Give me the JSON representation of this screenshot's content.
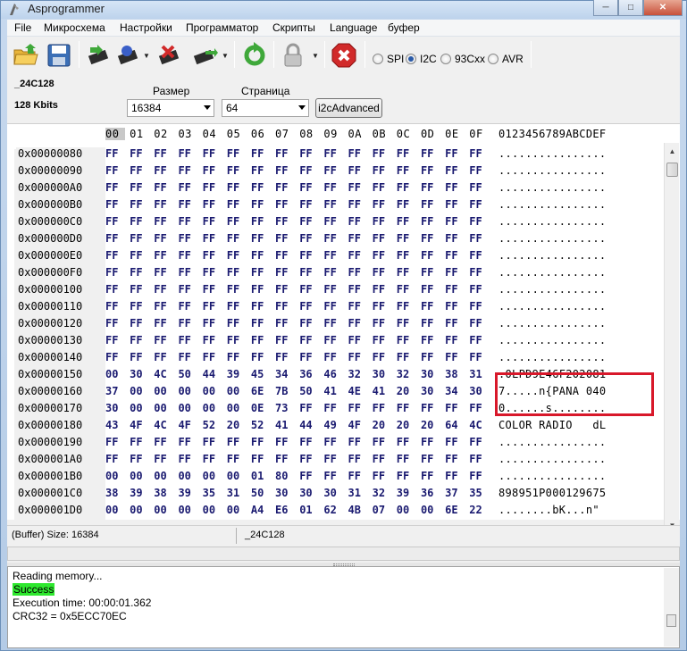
{
  "window": {
    "title": "Asprogrammer"
  },
  "menu": [
    "File",
    "Микросхема",
    "Настройки",
    "Программатор",
    "Скрипты",
    "Language",
    "буфер"
  ],
  "toolbar": {
    "icons": [
      "open-folder-icon",
      "save-disk-icon",
      "read-chip-icon",
      "write-chip-icon",
      "erase-chip-icon",
      "verify-chip-icon",
      "refresh-icon",
      "lock-icon",
      "stop-icon"
    ],
    "protocols": [
      {
        "label": "SPI",
        "selected": false
      },
      {
        "label": "I2C",
        "selected": true
      },
      {
        "label": "93Cxx",
        "selected": false
      },
      {
        "label": "AVR",
        "selected": false
      }
    ]
  },
  "chip": {
    "name": "_24C128",
    "size": "128 Kbits"
  },
  "size_field": {
    "label": "Размер",
    "value": "16384"
  },
  "page_field": {
    "label": "Страница",
    "value": "64"
  },
  "i2c_button": "i2cAdvanced",
  "hex": {
    "columns": [
      "00",
      "01",
      "02",
      "03",
      "04",
      "05",
      "06",
      "07",
      "08",
      "09",
      "0A",
      "0B",
      "0C",
      "0D",
      "0E",
      "0F"
    ],
    "ascii_header": "0123456789ABCDEF",
    "rows": [
      {
        "addr": "0x00000080",
        "bytes": [
          "FF",
          "FF",
          "FF",
          "FF",
          "FF",
          "FF",
          "FF",
          "FF",
          "FF",
          "FF",
          "FF",
          "FF",
          "FF",
          "FF",
          "FF",
          "FF"
        ],
        "ascii": "................"
      },
      {
        "addr": "0x00000090",
        "bytes": [
          "FF",
          "FF",
          "FF",
          "FF",
          "FF",
          "FF",
          "FF",
          "FF",
          "FF",
          "FF",
          "FF",
          "FF",
          "FF",
          "FF",
          "FF",
          "FF"
        ],
        "ascii": "................"
      },
      {
        "addr": "0x000000A0",
        "bytes": [
          "FF",
          "FF",
          "FF",
          "FF",
          "FF",
          "FF",
          "FF",
          "FF",
          "FF",
          "FF",
          "FF",
          "FF",
          "FF",
          "FF",
          "FF",
          "FF"
        ],
        "ascii": "................"
      },
      {
        "addr": "0x000000B0",
        "bytes": [
          "FF",
          "FF",
          "FF",
          "FF",
          "FF",
          "FF",
          "FF",
          "FF",
          "FF",
          "FF",
          "FF",
          "FF",
          "FF",
          "FF",
          "FF",
          "FF"
        ],
        "ascii": "................"
      },
      {
        "addr": "0x000000C0",
        "bytes": [
          "FF",
          "FF",
          "FF",
          "FF",
          "FF",
          "FF",
          "FF",
          "FF",
          "FF",
          "FF",
          "FF",
          "FF",
          "FF",
          "FF",
          "FF",
          "FF"
        ],
        "ascii": "................"
      },
      {
        "addr": "0x000000D0",
        "bytes": [
          "FF",
          "FF",
          "FF",
          "FF",
          "FF",
          "FF",
          "FF",
          "FF",
          "FF",
          "FF",
          "FF",
          "FF",
          "FF",
          "FF",
          "FF",
          "FF"
        ],
        "ascii": "................"
      },
      {
        "addr": "0x000000E0",
        "bytes": [
          "FF",
          "FF",
          "FF",
          "FF",
          "FF",
          "FF",
          "FF",
          "FF",
          "FF",
          "FF",
          "FF",
          "FF",
          "FF",
          "FF",
          "FF",
          "FF"
        ],
        "ascii": "................"
      },
      {
        "addr": "0x000000F0",
        "bytes": [
          "FF",
          "FF",
          "FF",
          "FF",
          "FF",
          "FF",
          "FF",
          "FF",
          "FF",
          "FF",
          "FF",
          "FF",
          "FF",
          "FF",
          "FF",
          "FF"
        ],
        "ascii": "................"
      },
      {
        "addr": "0x00000100",
        "bytes": [
          "FF",
          "FF",
          "FF",
          "FF",
          "FF",
          "FF",
          "FF",
          "FF",
          "FF",
          "FF",
          "FF",
          "FF",
          "FF",
          "FF",
          "FF",
          "FF"
        ],
        "ascii": "................"
      },
      {
        "addr": "0x00000110",
        "bytes": [
          "FF",
          "FF",
          "FF",
          "FF",
          "FF",
          "FF",
          "FF",
          "FF",
          "FF",
          "FF",
          "FF",
          "FF",
          "FF",
          "FF",
          "FF",
          "FF"
        ],
        "ascii": "................"
      },
      {
        "addr": "0x00000120",
        "bytes": [
          "FF",
          "FF",
          "FF",
          "FF",
          "FF",
          "FF",
          "FF",
          "FF",
          "FF",
          "FF",
          "FF",
          "FF",
          "FF",
          "FF",
          "FF",
          "FF"
        ],
        "ascii": "................"
      },
      {
        "addr": "0x00000130",
        "bytes": [
          "FF",
          "FF",
          "FF",
          "FF",
          "FF",
          "FF",
          "FF",
          "FF",
          "FF",
          "FF",
          "FF",
          "FF",
          "FF",
          "FF",
          "FF",
          "FF"
        ],
        "ascii": "................"
      },
      {
        "addr": "0x00000140",
        "bytes": [
          "FF",
          "FF",
          "FF",
          "FF",
          "FF",
          "FF",
          "FF",
          "FF",
          "FF",
          "FF",
          "FF",
          "FF",
          "FF",
          "FF",
          "FF",
          "FF"
        ],
        "ascii": "................"
      },
      {
        "addr": "0x00000150",
        "bytes": [
          "00",
          "30",
          "4C",
          "50",
          "44",
          "39",
          "45",
          "34",
          "36",
          "46",
          "32",
          "30",
          "32",
          "30",
          "38",
          "31"
        ],
        "ascii": ".0LPD9E46F202081"
      },
      {
        "addr": "0x00000160",
        "bytes": [
          "37",
          "00",
          "00",
          "00",
          "00",
          "00",
          "6E",
          "7B",
          "50",
          "41",
          "4E",
          "41",
          "20",
          "30",
          "34",
          "30"
        ],
        "ascii": "7.....n{PANA 040"
      },
      {
        "addr": "0x00000170",
        "bytes": [
          "30",
          "00",
          "00",
          "00",
          "00",
          "00",
          "0E",
          "73",
          "FF",
          "FF",
          "FF",
          "FF",
          "FF",
          "FF",
          "FF",
          "FF"
        ],
        "ascii": "0......s........"
      },
      {
        "addr": "0x00000180",
        "bytes": [
          "43",
          "4F",
          "4C",
          "4F",
          "52",
          "20",
          "52",
          "41",
          "44",
          "49",
          "4F",
          "20",
          "20",
          "20",
          "64",
          "4C"
        ],
        "ascii": "COLOR RADIO   dL"
      },
      {
        "addr": "0x00000190",
        "bytes": [
          "FF",
          "FF",
          "FF",
          "FF",
          "FF",
          "FF",
          "FF",
          "FF",
          "FF",
          "FF",
          "FF",
          "FF",
          "FF",
          "FF",
          "FF",
          "FF"
        ],
        "ascii": "................"
      },
      {
        "addr": "0x000001A0",
        "bytes": [
          "FF",
          "FF",
          "FF",
          "FF",
          "FF",
          "FF",
          "FF",
          "FF",
          "FF",
          "FF",
          "FF",
          "FF",
          "FF",
          "FF",
          "FF",
          "FF"
        ],
        "ascii": "................"
      },
      {
        "addr": "0x000001B0",
        "bytes": [
          "00",
          "00",
          "00",
          "00",
          "00",
          "00",
          "01",
          "80",
          "FF",
          "FF",
          "FF",
          "FF",
          "FF",
          "FF",
          "FF",
          "FF"
        ],
        "ascii": "................"
      },
      {
        "addr": "0x000001C0",
        "bytes": [
          "38",
          "39",
          "38",
          "39",
          "35",
          "31",
          "50",
          "30",
          "30",
          "30",
          "31",
          "32",
          "39",
          "36",
          "37",
          "35"
        ],
        "ascii": "898951P000129675"
      },
      {
        "addr": "0x000001D0",
        "bytes": [
          "00",
          "00",
          "00",
          "00",
          "00",
          "00",
          "A4",
          "E6",
          "01",
          "62",
          "4B",
          "07",
          "00",
          "00",
          "6E",
          "22"
        ],
        "ascii": "........bK...n\""
      }
    ]
  },
  "status": {
    "buffer_size": "(Buffer) Size: 16384",
    "chip": "_24C128"
  },
  "log": [
    "Reading memory...",
    "Success",
    "Execution time: 00:00:01.362",
    "CRC32 = 0x5ECC70EC"
  ],
  "colors": {
    "highlight_box": "#d8182a",
    "success_bg": "#2ee82e",
    "hex_text": "#1a1a70"
  }
}
